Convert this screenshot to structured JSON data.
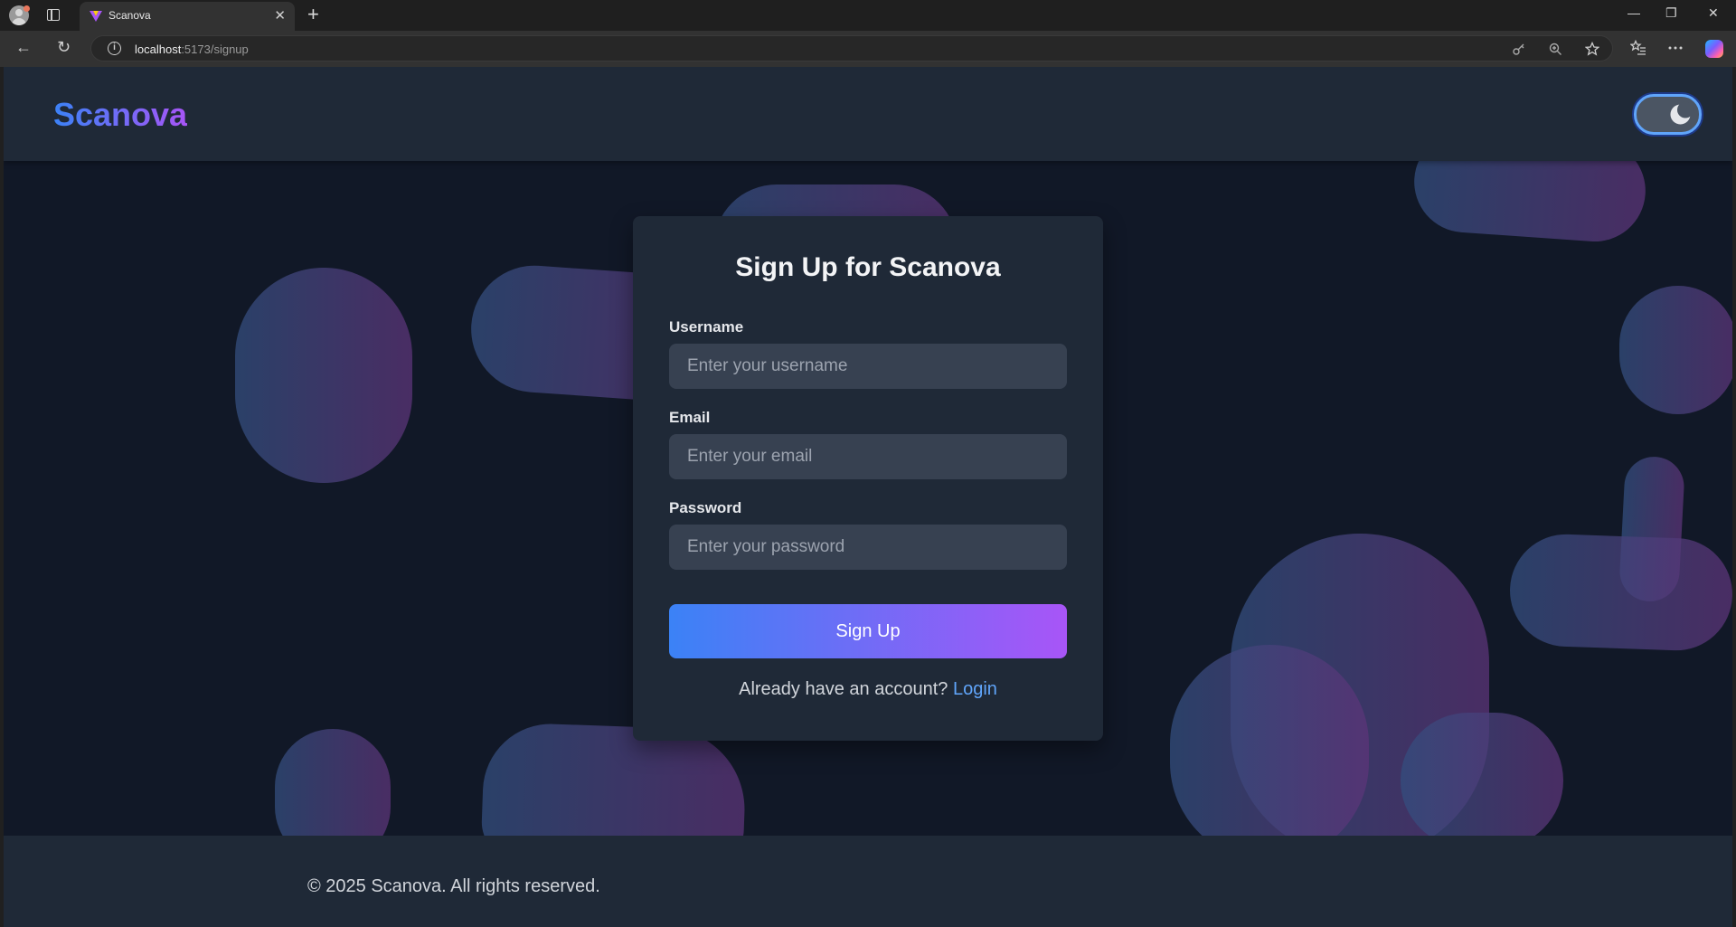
{
  "browser": {
    "tab_title": "Scanova",
    "url_host": "localhost",
    "url_path": ":5173/signup",
    "new_tab_symbol": "+",
    "close_symbol": "✕",
    "window_controls": {
      "minimize": "—",
      "restore": "❐",
      "close": "✕"
    },
    "nav": {
      "back": "←",
      "reload": "↻"
    }
  },
  "header": {
    "logo": "Scanova",
    "theme_toggle_icon": "moon-icon"
  },
  "form": {
    "title": "Sign Up for Scanova",
    "username_label": "Username",
    "username_placeholder": "Enter your username",
    "email_label": "Email",
    "email_placeholder": "Enter your email",
    "password_label": "Password",
    "password_placeholder": "Enter your password",
    "submit_label": "Sign Up",
    "switch_text": "Already have an account?",
    "switch_link": "Login"
  },
  "footer": {
    "text": "© 2025 Scanova. All rights reserved."
  },
  "colors": {
    "page_bg": "#111827",
    "panel_bg": "#1f2937",
    "input_bg": "#374151",
    "accent_start": "#3b82f6",
    "accent_end": "#a855f7",
    "link": "#60a5fa"
  }
}
